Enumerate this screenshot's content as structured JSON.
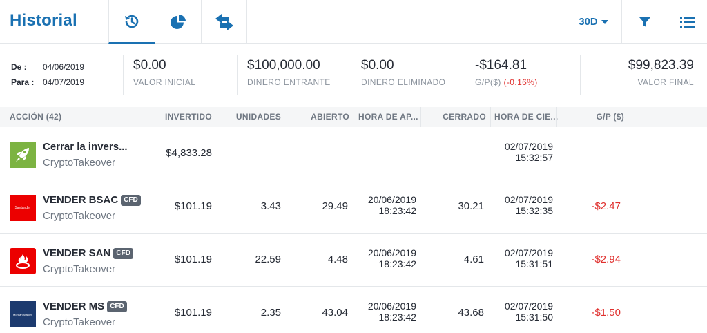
{
  "header": {
    "title": "Historial",
    "tabs": [
      {
        "icon": "history-icon"
      },
      {
        "icon": "pie-chart-icon"
      },
      {
        "icon": "transfer-arrows-icon"
      }
    ],
    "period": "30D",
    "filter_icon": "filter-icon",
    "list_icon": "list-icon",
    "accent": "#1a71b2"
  },
  "summary": {
    "from_label": "De :",
    "from_value": "04/06/2019",
    "to_label": "Para :",
    "to_value": "04/07/2019",
    "stats": [
      {
        "value": "$0.00",
        "label": "VALOR INICIAL"
      },
      {
        "value": "$100,000.00",
        "label": "DINERO ENTRANTE"
      },
      {
        "value": "$0.00",
        "label": "DINERO ELIMINADO"
      },
      {
        "value": "-$164.81",
        "label": "G/P($)",
        "extra": "(-0.16%)"
      },
      {
        "value": "$99,823.39",
        "label": "VALOR FINAL"
      }
    ]
  },
  "table": {
    "columns": {
      "action": "ACCIÓN (42)",
      "invested": "INVERTIDO",
      "units": "UNIDADES",
      "open": "ABIERTO",
      "open_time": "HORA DE AP...",
      "closed": "CERRADO",
      "close_time": "HORA DE CIE...",
      "pl": "G/P ($)"
    },
    "rows": [
      {
        "logo": "rocket-icon",
        "name": "Cerrar la invers...",
        "cfd": "",
        "sub": "CryptoTakeover",
        "invested": "$4,833.28",
        "units": "",
        "open": "",
        "open_date": "",
        "open_time": "",
        "closed": "",
        "close_date": "02/07/2019",
        "close_time": "15:32:57",
        "pl": ""
      },
      {
        "logo": "santander-logo",
        "logo_text": "Santander",
        "name": "VENDER BSAC",
        "cfd": "CFD",
        "sub": "CryptoTakeover",
        "invested": "$101.19",
        "units": "3.43",
        "open": "29.49",
        "open_date": "20/06/2019",
        "open_time": "18:23:42",
        "closed": "30.21",
        "close_date": "02/07/2019",
        "close_time": "15:32:35",
        "pl": "-$2.47"
      },
      {
        "logo": "santander-flame-icon",
        "name": "VENDER SAN",
        "cfd": "CFD",
        "sub": "CryptoTakeover",
        "invested": "$101.19",
        "units": "22.59",
        "open": "4.48",
        "open_date": "20/06/2019",
        "open_time": "18:23:42",
        "closed": "4.61",
        "close_date": "02/07/2019",
        "close_time": "15:31:51",
        "pl": "-$2.94"
      },
      {
        "logo": "morgan-stanley-logo",
        "logo_text": "Morgan Stanley",
        "name": "VENDER MS",
        "cfd": "CFD",
        "sub": "CryptoTakeover",
        "invested": "$101.19",
        "units": "2.35",
        "open": "43.04",
        "open_date": "20/06/2019",
        "open_time": "18:23:42",
        "closed": "43.68",
        "close_date": "02/07/2019",
        "close_time": "15:31:50",
        "pl": "-$1.50"
      }
    ]
  },
  "colors": {
    "negative": "#e0312f",
    "santander": "#ec0000",
    "morgan_stanley": "#1c3a6e",
    "rocket_bg": "#7cb342"
  }
}
